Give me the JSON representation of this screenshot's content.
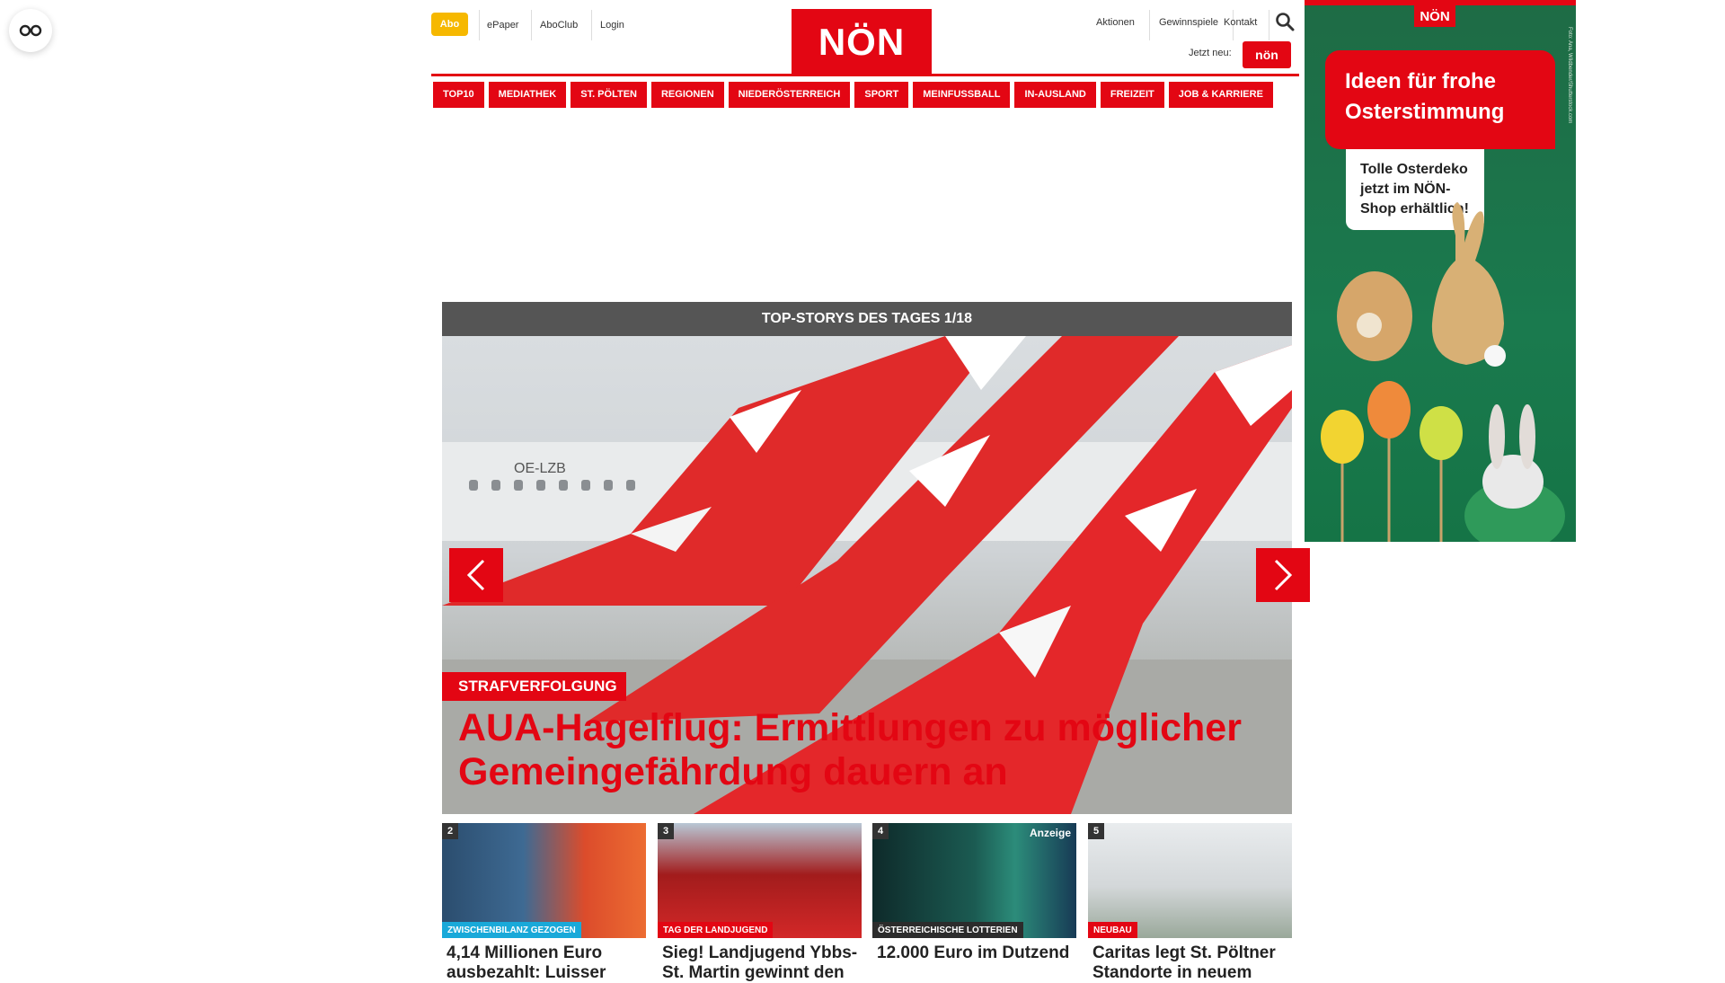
{
  "header": {
    "abo_label": "Abo",
    "epaper_label": "ePaper",
    "aboclub_label": "AboClub",
    "login_label": "Login",
    "logo_text": "NÖN",
    "aktionen_label": "Aktionen",
    "gewinnspiele_label": "Gewinnspiele",
    "kontakt_label": "Kontakt",
    "jetzt_neu_label": "Jetzt neu:",
    "magazine_badge": "nön"
  },
  "nav": {
    "items": [
      {
        "label": "TOP10"
      },
      {
        "label": "MEDIATHEK"
      },
      {
        "label": "ST. PÖLTEN"
      },
      {
        "label": "REGIONEN"
      },
      {
        "label": "NIEDERÖSTERREICH"
      },
      {
        "label": "SPORT"
      },
      {
        "label": "MEINFUSSBALL"
      },
      {
        "label": "IN-AUSLAND"
      },
      {
        "label": "FREIZEIT"
      },
      {
        "label": "JOB & KARRIERE"
      }
    ]
  },
  "ad": {
    "logo": "NÖN",
    "headline": "Ideen für frohe Osterstimmung",
    "subtext": "Tolle Osterdeko jetzt im NÖN-Shop erhältlich!",
    "credit": "Foto: Ana, Wildbender/Shutterstock.com"
  },
  "hero": {
    "header": "TOP-STORYS DES TAGES 1/18",
    "category": "STRAFVERFOLGUNG",
    "headline": "AUA-Hagelflug: Ermittlungen zu möglicher Gemeingefährdung dauern an",
    "plane_reg": "OE-LZB"
  },
  "tiles": [
    {
      "num": "2",
      "tag": "ZWISCHENBILANZ GEZOGEN",
      "tag_color": "#19a9d9",
      "title": "4,14 Millionen Euro ausbezahlt: Luisser"
    },
    {
      "num": "3",
      "tag": "TAG DER LANDJUGEND",
      "tag_color": "#e30613",
      "title": "Sieg! Landjugend Ybbs-St. Martin gewinnt den"
    },
    {
      "num": "4",
      "tag": "ÖSTERREICHISCHE LOTTERIEN",
      "tag_color": "#2c2c2c",
      "title": "12.000 Euro im Dutzend",
      "anzeige": "Anzeige"
    },
    {
      "num": "5",
      "tag": "NEUBAU",
      "tag_color": "#e30613",
      "title": "Caritas legt St. Pöltner Standorte in neuem"
    }
  ]
}
